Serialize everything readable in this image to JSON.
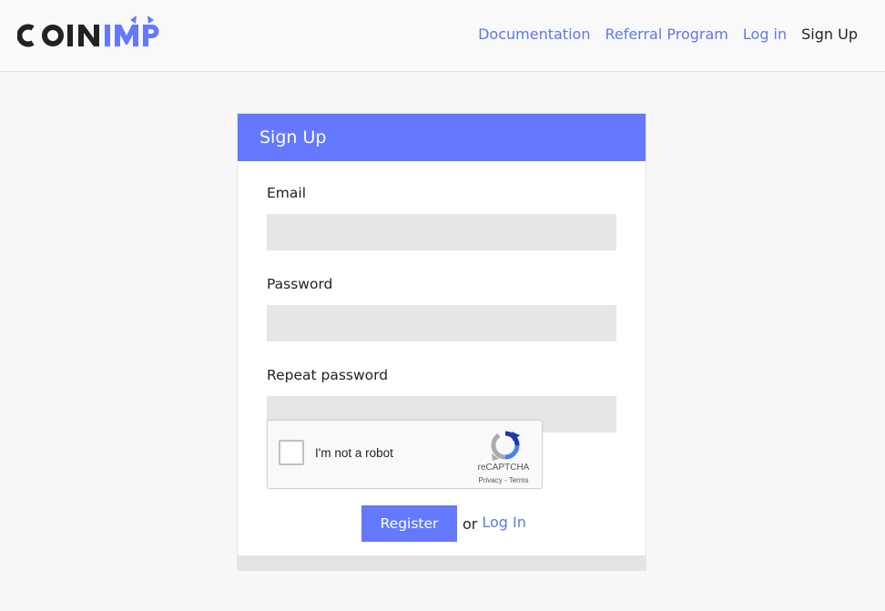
{
  "brand": {
    "name": "COINIMP",
    "accent_color": "#6479fe"
  },
  "nav": {
    "items": [
      {
        "label": "Documentation"
      },
      {
        "label": "Referral Program"
      },
      {
        "label": "Log in"
      },
      {
        "label": "Sign Up",
        "current": true
      }
    ]
  },
  "signup": {
    "title": "Sign Up",
    "email": {
      "label": "Email",
      "value": "",
      "placeholder": ""
    },
    "password": {
      "label": "Password",
      "value": "",
      "placeholder": ""
    },
    "repeat_password": {
      "label": "Repeat password",
      "value": "",
      "placeholder": ""
    },
    "captcha": {
      "checkbox_label": "I'm not a robot",
      "brand": "reCAPTCHA",
      "links": "Privacy - Terms",
      "checked": false
    },
    "register_label": "Register",
    "or_text": "or",
    "login_link": "Log In"
  }
}
